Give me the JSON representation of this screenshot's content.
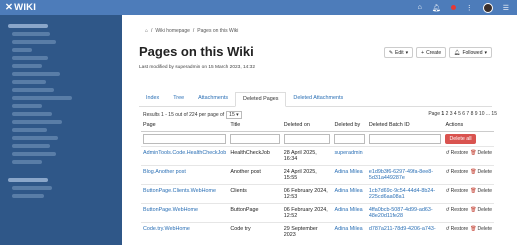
{
  "app": {
    "title": "WIKI"
  },
  "topbar": {
    "icons": [
      "home-icon",
      "bell-icon",
      "grid-icon",
      "avatar"
    ]
  },
  "breadcrumb": {
    "home": "⌂",
    "wiki": "Wiki homepage",
    "page": "Pages on this Wiki"
  },
  "page": {
    "title": "Pages on this Wiki",
    "modified": "Last modified by superadmin on 15 March 2023, 14:32"
  },
  "buttons": {
    "edit": "Edit",
    "create": "Create",
    "followed": "Followed"
  },
  "tabs": [
    {
      "label": "Index"
    },
    {
      "label": "Tree"
    },
    {
      "label": "Attachments"
    },
    {
      "label": "Deleted Pages"
    },
    {
      "label": "Deleted Attachments"
    }
  ],
  "results": {
    "prefix": "Results 1 - 15 out of 224 per page of",
    "per_page": "15"
  },
  "paging": {
    "label": "Page",
    "current": "1",
    "rest": "2 3 4 5 6 7 8 9 10 ... 15"
  },
  "table": {
    "headers": [
      "Page",
      "Title",
      "Deleted on",
      "Deleted by",
      "Deleted Batch ID",
      "Actions"
    ],
    "delete_all": "Delete all",
    "restore": "Restore",
    "delete": "Delete",
    "rows": [
      {
        "page": "AdminTools.Code.HealthCheckJob",
        "title": "HealthCheckJob",
        "date": "28 April 2025, 16:34",
        "by": "superadmin",
        "batch": ""
      },
      {
        "page": "Blog.Another post",
        "title": "Another post",
        "date": "24 April 2025, 15:55",
        "by": "Adina Milea",
        "batch": "e1d9b3f6-6297-49fa-8ee8-5d31a449287e"
      },
      {
        "page": "ButtonPage.Clients.WebHome",
        "title": "Clients",
        "date": "06 February 2024, 12:53",
        "by": "Adina Milea",
        "batch": "1cb7d69c-9c54-44d4-8b24-225cd6aa08a1"
      },
      {
        "page": "ButtonPage.WebHome",
        "title": "ButtonPage",
        "date": "06 February 2024, 12:52",
        "by": "Adina Milea",
        "batch": "4ffa0bcb-5087-4d99-ad63-48e20d11fe28"
      },
      {
        "page": "Code.try.WebHome",
        "title": "Code try",
        "date": "29 September 2023",
        "by": "Adina Milea",
        "batch": "d787a211-78d9-4206-a743-"
      }
    ]
  }
}
